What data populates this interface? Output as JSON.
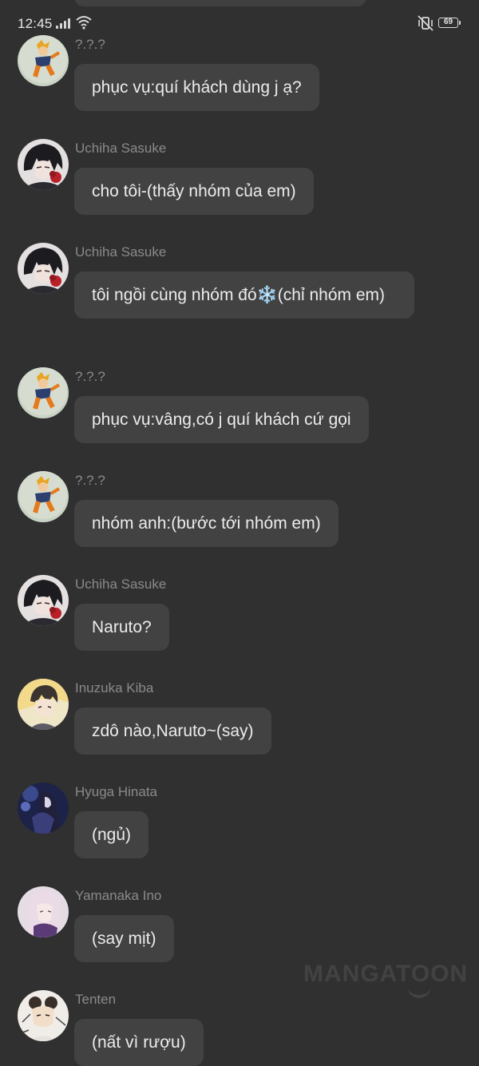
{
  "status_bar": {
    "time": "12:45",
    "battery": "69"
  },
  "watermark": "MANGATOON",
  "messages": [
    {
      "sender": "?.?.?",
      "avatar": "naruto-avatar",
      "text": "phục vụ:quí khách dùng j ạ?"
    },
    {
      "sender": "Uchiha Sasuke",
      "avatar": "sasuke-avatar",
      "text": "cho tôi-(thấy nhóm của em)"
    },
    {
      "sender": "Uchiha Sasuke",
      "avatar": "sasuke-avatar",
      "text": "tôi ngồi cùng nhóm đó❄️(chỉ nhóm em)"
    },
    {
      "sender": "?.?.?",
      "avatar": "naruto-avatar",
      "text": "phục vụ:vâng,có j quí khách cứ gọi"
    },
    {
      "sender": "?.?.?",
      "avatar": "naruto-avatar",
      "text": "nhóm anh:(bước tới nhóm em)"
    },
    {
      "sender": "Uchiha Sasuke",
      "avatar": "sasuke-avatar",
      "text": "Naruto?"
    },
    {
      "sender": "Inuzuka Kiba",
      "avatar": "kiba-avatar",
      "text": "zdô nào,Naruto~(say)"
    },
    {
      "sender": "Hyuga Hinata",
      "avatar": "hinata-avatar",
      "text": "(ngủ)"
    },
    {
      "sender": "Yamanaka Ino",
      "avatar": "ino-avatar",
      "text": "(say mịt)"
    },
    {
      "sender": "Tenten",
      "avatar": "tenten-avatar",
      "text": "(nất vì rượu)"
    }
  ]
}
